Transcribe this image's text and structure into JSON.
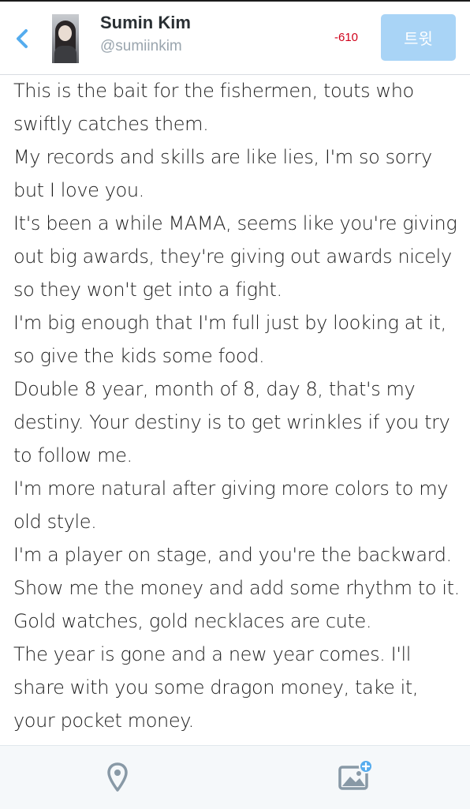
{
  "header": {
    "display_name": "Sumin Kim",
    "handle": "@sumiinkim",
    "char_counter": "-610",
    "tweet_button_label": "트윗"
  },
  "compose": {
    "lines": [
      "This is the bait for the fishermen, touts who",
      "swiftly catches them.",
      "My records and skills are like lies, I'm so sorry",
      "but I love you.",
      "It's been a while MAMA, seems like you're giving",
      "out big awards, they're giving out awards nicely",
      "so they won't get into a fight.",
      "I'm big enough that I'm full just by looking at it,",
      "so give the kids some food.",
      "Double 8 year, month of 8, day 8, that's my",
      "destiny. Your destiny is to get wrinkles if you try",
      "to follow me.",
      "I'm more natural after giving more colors to my",
      "old style.",
      "I'm a player on stage, and you're the backward.",
      "Show me the money and add some rhythm to it.",
      "Gold watches, gold necklaces are cute.",
      "The year is gone and a new year comes. I'll",
      "share with you some dragon money, take it,",
      "your pocket money."
    ]
  },
  "toolbar": {
    "location_icon": "location-pin-icon",
    "image_icon": "add-photo-icon"
  },
  "colors": {
    "accent": "#55acee",
    "tweet_button_disabled": "#a9d4f6",
    "counter_negative": "#d0021b",
    "toolbar_icon": "#8899a6"
  }
}
